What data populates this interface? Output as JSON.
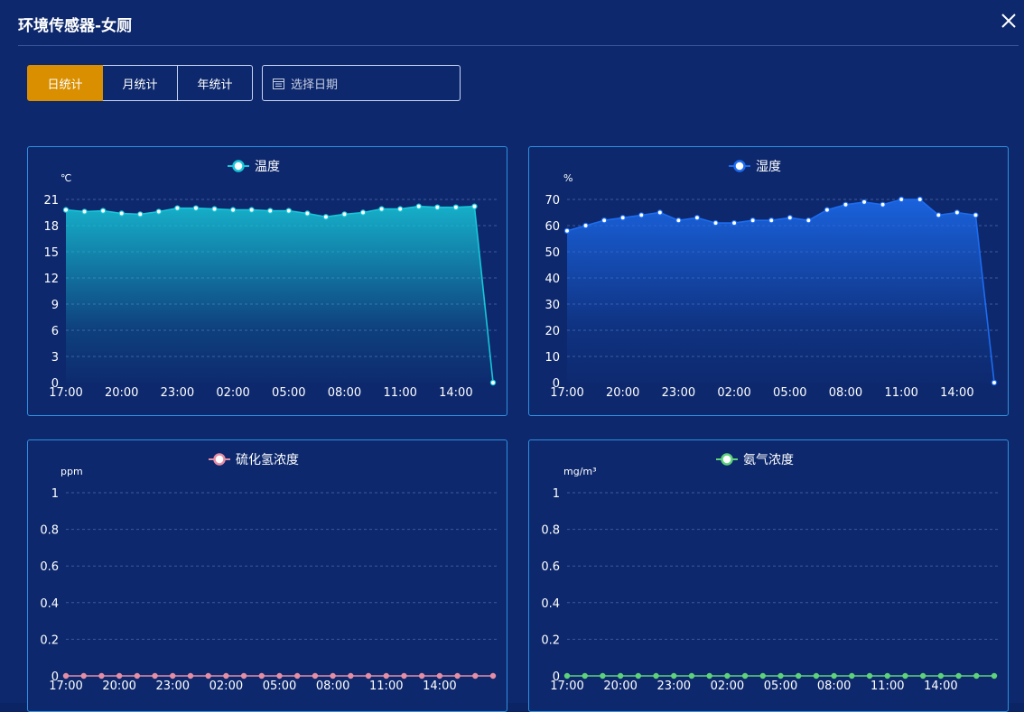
{
  "modal": {
    "title": "环境传感器-女厕"
  },
  "tabs": [
    {
      "label": "日统计",
      "active": true
    },
    {
      "label": "月统计",
      "active": false
    },
    {
      "label": "年统计",
      "active": false
    }
  ],
  "date_picker": {
    "placeholder": "选择日期",
    "icon": "calendar-icon"
  },
  "colors": {
    "accent": "#d98f00",
    "border": "#2e90e0",
    "background": "#0d286d"
  },
  "chart_data": [
    {
      "type": "area",
      "title": "",
      "unit": "℃",
      "legend": "温度",
      "color": "#17c6d8",
      "ylim": [
        0,
        21
      ],
      "yticks": [
        "0",
        "3",
        "6",
        "9",
        "12",
        "15",
        "18",
        "21"
      ],
      "xticks": [
        "17:00",
        "20:00",
        "23:00",
        "02:00",
        "05:00",
        "08:00",
        "11:00",
        "14:00"
      ],
      "values": [
        19.8,
        19.6,
        19.7,
        19.4,
        19.3,
        19.6,
        20.0,
        20.0,
        19.9,
        19.8,
        19.8,
        19.7,
        19.7,
        19.4,
        19.0,
        19.3,
        19.5,
        19.9,
        19.9,
        20.2,
        20.1,
        20.1,
        20.2,
        0
      ]
    },
    {
      "type": "area",
      "title": "",
      "unit": "%",
      "legend": "湿度",
      "color": "#1c6cf0",
      "ylim": [
        0,
        70
      ],
      "yticks": [
        "0",
        "10",
        "20",
        "30",
        "40",
        "50",
        "60",
        "70"
      ],
      "xticks": [
        "17:00",
        "20:00",
        "23:00",
        "02:00",
        "05:00",
        "08:00",
        "11:00",
        "14:00"
      ],
      "values": [
        58,
        60,
        62,
        63,
        64,
        65,
        62,
        63,
        61,
        61,
        62,
        62,
        63,
        62,
        66,
        68,
        69,
        68,
        70,
        70,
        64,
        65,
        64,
        0
      ]
    },
    {
      "type": "line",
      "title": "",
      "unit": "ppm",
      "legend": "硫化氢浓度",
      "color": "#e48ea6",
      "ylim": [
        0,
        1
      ],
      "yticks": [
        "0",
        "0.2",
        "0.4",
        "0.6",
        "0.8",
        "1"
      ],
      "xticks": [
        "17:00",
        "20:00",
        "23:00",
        "02:00",
        "05:00",
        "08:00",
        "11:00",
        "14:00"
      ],
      "values": [
        0,
        0,
        0,
        0,
        0,
        0,
        0,
        0,
        0,
        0,
        0,
        0,
        0,
        0,
        0,
        0,
        0,
        0,
        0,
        0,
        0,
        0,
        0,
        0,
        0
      ]
    },
    {
      "type": "line",
      "title": "",
      "unit": "mg/m³",
      "legend": "氨气浓度",
      "color": "#5ed27a",
      "ylim": [
        0,
        1
      ],
      "yticks": [
        "0",
        "0.2",
        "0.4",
        "0.6",
        "0.8",
        "1"
      ],
      "xticks": [
        "17:00",
        "20:00",
        "23:00",
        "02:00",
        "05:00",
        "08:00",
        "11:00",
        "14:00"
      ],
      "values": [
        0,
        0,
        0,
        0,
        0,
        0,
        0,
        0,
        0,
        0,
        0,
        0,
        0,
        0,
        0,
        0,
        0,
        0,
        0,
        0,
        0,
        0,
        0,
        0,
        0
      ]
    }
  ]
}
